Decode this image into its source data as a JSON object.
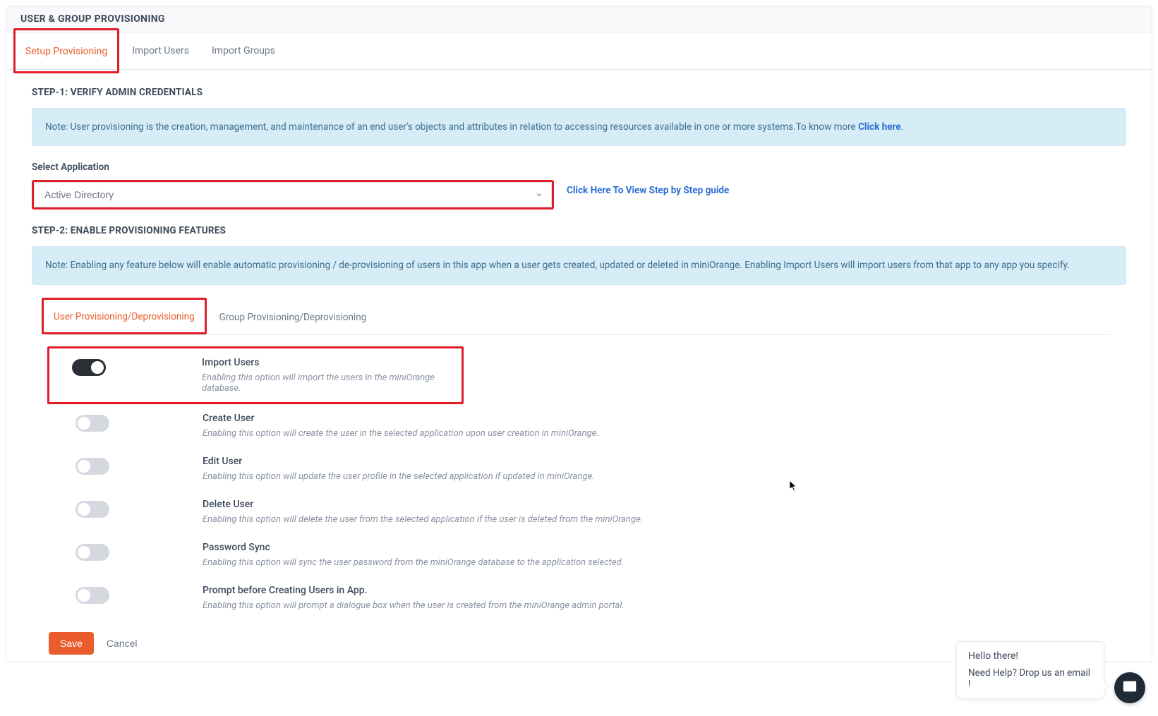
{
  "panel": {
    "title": "USER & GROUP PROVISIONING"
  },
  "tabs": {
    "items": [
      {
        "label": "Setup Provisioning",
        "active": true
      },
      {
        "label": "Import Users",
        "active": false
      },
      {
        "label": "Import Groups",
        "active": false
      }
    ]
  },
  "step1": {
    "title": "STEP-1: VERIFY ADMIN CREDENTIALS",
    "note_prefix": "Note: User provisioning is the creation, management, and maintenance of an end user's objects and attributes in relation to accessing resources available in one or more systems.To know more ",
    "note_link": "Click here",
    "note_suffix": ".",
    "field_label": "Select Application",
    "select_value": "Active Directory",
    "guide_link": "Click Here To View Step by Step guide"
  },
  "step2": {
    "title": "STEP-2: ENABLE PROVISIONING FEATURES",
    "note": "Note: Enabling any feature below will enable automatic provisioning / de-provisioning of users in this app when a user gets created, updated or deleted in miniOrange. Enabling Import Users will import users from that app to any app you specify."
  },
  "subtabs": {
    "items": [
      {
        "label": "User Provisioning/Deprovisioning",
        "active": true
      },
      {
        "label": "Group Provisioning/Deprovisioning",
        "active": false
      }
    ]
  },
  "features": [
    {
      "on": true,
      "title": "Import Users",
      "desc": "Enabling this option will import the users in the miniOrange database."
    },
    {
      "on": false,
      "title": "Create User",
      "desc": "Enabling this option will create the user in the selected application upon user creation in miniOrange."
    },
    {
      "on": false,
      "title": "Edit User",
      "desc": "Enabling this option will update the user profile in the selected application if updated in miniOrange."
    },
    {
      "on": false,
      "title": "Delete User",
      "desc": "Enabling this option will delete the user from the selected application if the user is deleted from the miniOrange."
    },
    {
      "on": false,
      "title": "Password Sync",
      "desc": "Enabling this option will sync the user password from the miniOrange database to the application selected."
    },
    {
      "on": false,
      "title": "Prompt before Creating Users in App.",
      "desc": "Enabling this option will prompt a dialogue box when the user is created from the miniOrange admin portal."
    }
  ],
  "actions": {
    "save": "Save",
    "cancel": "Cancel"
  },
  "help": {
    "hello": "Hello there!",
    "ask": "Need Help? Drop us an email !"
  }
}
